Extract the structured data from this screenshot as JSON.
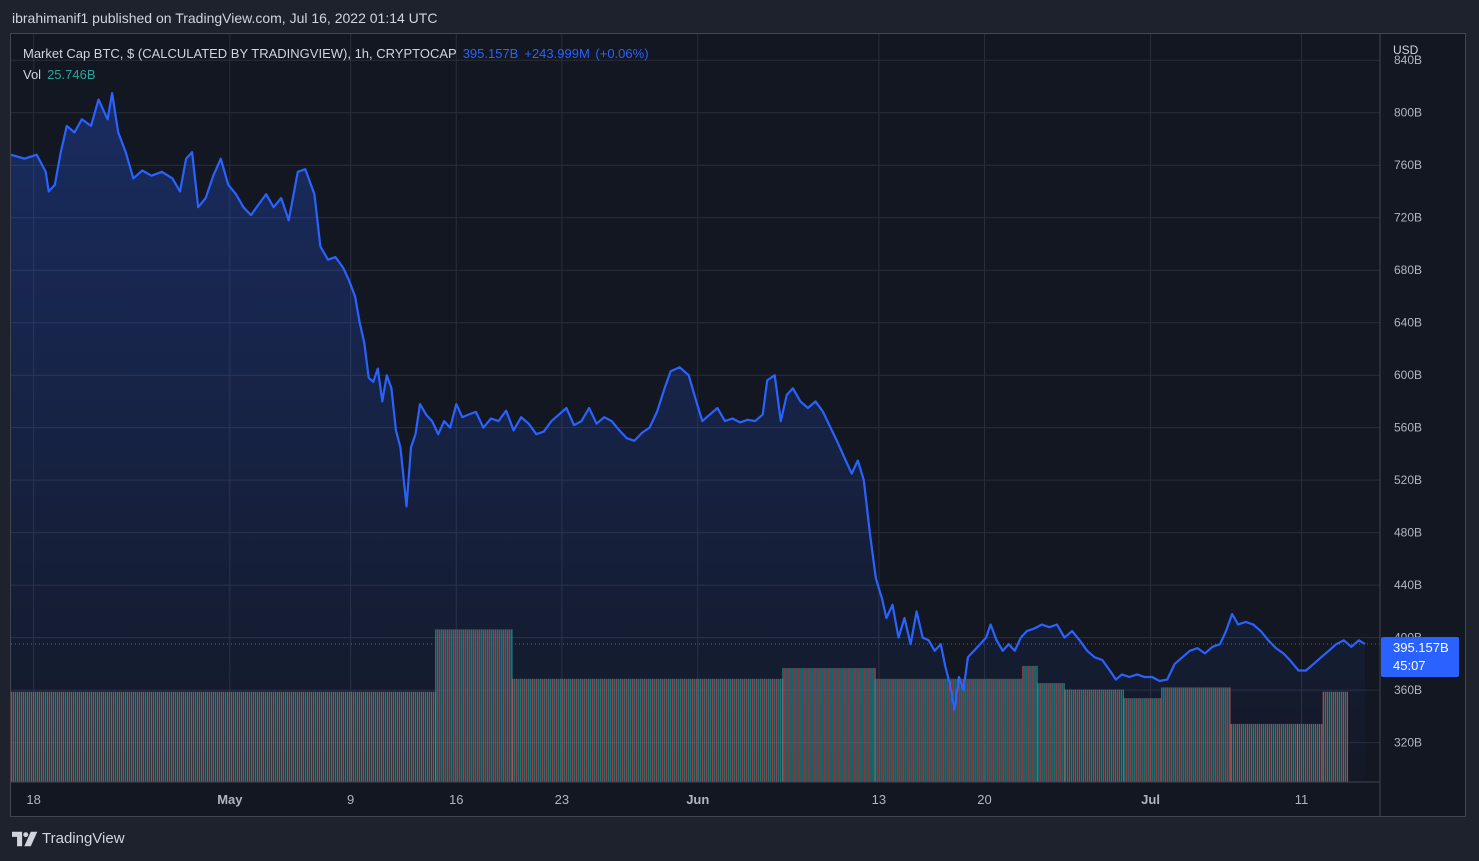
{
  "header": {
    "publisher_text": "ibrahimanif1 published on TradingView.com, Jul 16, 2022 01:14 UTC"
  },
  "legend": {
    "symbol": "Market Cap BTC, $ (CALCULATED BY TRADINGVIEW), 1h, CRYPTOCAP",
    "last_value": "395.157B",
    "change": "+243.999M",
    "change_pct": "(+0.06%)",
    "vol_label": "Vol",
    "vol_value": "25.746B"
  },
  "axis": {
    "currency": "USD"
  },
  "price_tag": {
    "value": "395.157B",
    "countdown": "45:07"
  },
  "footer": {
    "brand": "TradingView"
  },
  "colors": {
    "background": "#131722",
    "line": "#2962ff",
    "volume_up": "#26a69a",
    "volume_down": "#ef5350",
    "grid": "#2a2e39"
  },
  "chart_data": {
    "type": "line",
    "title": "Market Cap BTC",
    "xlabel": "",
    "ylabel": "USD",
    "ylim": [
      290,
      860
    ],
    "y_ticks": [
      320,
      360,
      400,
      440,
      480,
      520,
      560,
      600,
      640,
      680,
      720,
      760,
      800,
      840
    ],
    "y_tick_labels": [
      "320B",
      "360B",
      "400B",
      "440B",
      "480B",
      "520B",
      "560B",
      "600B",
      "640B",
      "680B",
      "720B",
      "760B",
      "800B",
      "840B"
    ],
    "x_ticks": [
      {
        "label": "18",
        "day": 0,
        "bold": false
      },
      {
        "label": "May",
        "day": 13,
        "bold": true
      },
      {
        "label": "9",
        "day": 21,
        "bold": false
      },
      {
        "label": "16",
        "day": 28,
        "bold": false
      },
      {
        "label": "23",
        "day": 35,
        "bold": false
      },
      {
        "label": "Jun",
        "day": 44,
        "bold": true
      },
      {
        "label": "13",
        "day": 56,
        "bold": false
      },
      {
        "label": "20",
        "day": 63,
        "bold": false
      },
      {
        "label": "Jul",
        "day": 74,
        "bold": true
      },
      {
        "label": "11",
        "day": 84,
        "bold": false
      }
    ],
    "x_domain": [
      -1.5,
      89.2
    ],
    "series": [
      {
        "points": [
          [
            -1.5,
            768
          ],
          [
            -0.6,
            765
          ],
          [
            0.2,
            768
          ],
          [
            0.8,
            755
          ],
          [
            1.0,
            740
          ],
          [
            1.4,
            745
          ],
          [
            1.8,
            770
          ],
          [
            2.2,
            790
          ],
          [
            2.7,
            785
          ],
          [
            3.2,
            795
          ],
          [
            3.8,
            790
          ],
          [
            4.3,
            810
          ],
          [
            4.9,
            795
          ],
          [
            5.2,
            815
          ],
          [
            5.6,
            785
          ],
          [
            6.1,
            770
          ],
          [
            6.6,
            750
          ],
          [
            7.2,
            756
          ],
          [
            7.8,
            752
          ],
          [
            8.5,
            755
          ],
          [
            9.2,
            750
          ],
          [
            9.7,
            740
          ],
          [
            10.1,
            765
          ],
          [
            10.5,
            770
          ],
          [
            10.9,
            728
          ],
          [
            11.4,
            735
          ],
          [
            11.9,
            752
          ],
          [
            12.4,
            765
          ],
          [
            12.9,
            745
          ],
          [
            13.4,
            738
          ],
          [
            13.9,
            728
          ],
          [
            14.4,
            722
          ],
          [
            14.9,
            730
          ],
          [
            15.4,
            738
          ],
          [
            15.9,
            728
          ],
          [
            16.4,
            735
          ],
          [
            16.9,
            718
          ],
          [
            17.5,
            755
          ],
          [
            18.0,
            757
          ],
          [
            18.6,
            738
          ],
          [
            19.0,
            698
          ],
          [
            19.5,
            688
          ],
          [
            20.0,
            690
          ],
          [
            20.5,
            682
          ],
          [
            20.9,
            672
          ],
          [
            21.3,
            660
          ],
          [
            21.6,
            640
          ],
          [
            21.9,
            625
          ],
          [
            22.2,
            598
          ],
          [
            22.5,
            595
          ],
          [
            22.8,
            605
          ],
          [
            23.1,
            580
          ],
          [
            23.4,
            600
          ],
          [
            23.7,
            590
          ],
          [
            24.0,
            558
          ],
          [
            24.3,
            545
          ],
          [
            24.5,
            523
          ],
          [
            24.7,
            500
          ],
          [
            25.0,
            545
          ],
          [
            25.3,
            555
          ],
          [
            25.6,
            578
          ],
          [
            26.0,
            570
          ],
          [
            26.4,
            565
          ],
          [
            26.8,
            555
          ],
          [
            27.2,
            565
          ],
          [
            27.6,
            560
          ],
          [
            28.0,
            578
          ],
          [
            28.4,
            568
          ],
          [
            28.8,
            570
          ],
          [
            29.3,
            572
          ],
          [
            29.8,
            560
          ],
          [
            30.3,
            567
          ],
          [
            30.8,
            565
          ],
          [
            31.3,
            573
          ],
          [
            31.8,
            558
          ],
          [
            32.3,
            568
          ],
          [
            32.8,
            563
          ],
          [
            33.3,
            555
          ],
          [
            33.8,
            557
          ],
          [
            34.3,
            565
          ],
          [
            34.8,
            570
          ],
          [
            35.3,
            575
          ],
          [
            35.8,
            562
          ],
          [
            36.3,
            565
          ],
          [
            36.8,
            575
          ],
          [
            37.3,
            563
          ],
          [
            37.8,
            568
          ],
          [
            38.3,
            565
          ],
          [
            38.8,
            558
          ],
          [
            39.3,
            552
          ],
          [
            39.8,
            550
          ],
          [
            40.3,
            556
          ],
          [
            40.8,
            560
          ],
          [
            41.3,
            572
          ],
          [
            41.8,
            590
          ],
          [
            42.2,
            603
          ],
          [
            42.8,
            606
          ],
          [
            43.4,
            600
          ],
          [
            43.9,
            580
          ],
          [
            44.3,
            565
          ],
          [
            44.8,
            570
          ],
          [
            45.3,
            575
          ],
          [
            45.8,
            565
          ],
          [
            46.3,
            567
          ],
          [
            46.8,
            564
          ],
          [
            47.3,
            566
          ],
          [
            47.8,
            565
          ],
          [
            48.3,
            570
          ],
          [
            48.6,
            596
          ],
          [
            49.1,
            600
          ],
          [
            49.5,
            565
          ],
          [
            49.9,
            585
          ],
          [
            50.3,
            590
          ],
          [
            50.8,
            580
          ],
          [
            51.3,
            575
          ],
          [
            51.8,
            580
          ],
          [
            52.3,
            572
          ],
          [
            52.8,
            560
          ],
          [
            53.3,
            548
          ],
          [
            53.8,
            535
          ],
          [
            54.2,
            525
          ],
          [
            54.6,
            535
          ],
          [
            55.0,
            520
          ],
          [
            55.4,
            480
          ],
          [
            55.8,
            445
          ],
          [
            56.2,
            430
          ],
          [
            56.5,
            415
          ],
          [
            56.9,
            425
          ],
          [
            57.3,
            400
          ],
          [
            57.7,
            415
          ],
          [
            58.1,
            395
          ],
          [
            58.5,
            420
          ],
          [
            58.9,
            400
          ],
          [
            59.3,
            398
          ],
          [
            59.7,
            390
          ],
          [
            60.1,
            395
          ],
          [
            60.4,
            378
          ],
          [
            60.7,
            365
          ],
          [
            61.0,
            345
          ],
          [
            61.3,
            370
          ],
          [
            61.6,
            360
          ],
          [
            61.9,
            385
          ],
          [
            62.3,
            390
          ],
          [
            62.7,
            395
          ],
          [
            63.1,
            400
          ],
          [
            63.4,
            410
          ],
          [
            63.8,
            398
          ],
          [
            64.2,
            390
          ],
          [
            64.6,
            395
          ],
          [
            65.0,
            390
          ],
          [
            65.4,
            400
          ],
          [
            65.8,
            405
          ],
          [
            66.3,
            407
          ],
          [
            66.8,
            410
          ],
          [
            67.3,
            408
          ],
          [
            67.8,
            410
          ],
          [
            68.3,
            400
          ],
          [
            68.8,
            405
          ],
          [
            69.3,
            398
          ],
          [
            69.8,
            390
          ],
          [
            70.3,
            385
          ],
          [
            70.8,
            383
          ],
          [
            71.3,
            375
          ],
          [
            71.7,
            368
          ],
          [
            72.1,
            372
          ],
          [
            72.6,
            370
          ],
          [
            73.1,
            372
          ],
          [
            73.6,
            370
          ],
          [
            74.1,
            370
          ],
          [
            74.6,
            367
          ],
          [
            75.1,
            368
          ],
          [
            75.6,
            380
          ],
          [
            76.1,
            385
          ],
          [
            76.6,
            390
          ],
          [
            77.1,
            392
          ],
          [
            77.6,
            388
          ],
          [
            78.1,
            393
          ],
          [
            78.6,
            395
          ],
          [
            79.0,
            405
          ],
          [
            79.4,
            418
          ],
          [
            79.8,
            410
          ],
          [
            80.3,
            412
          ],
          [
            80.8,
            410
          ],
          [
            81.3,
            405
          ],
          [
            81.8,
            398
          ],
          [
            82.3,
            392
          ],
          [
            82.8,
            388
          ],
          [
            83.3,
            382
          ],
          [
            83.8,
            375
          ],
          [
            84.3,
            375
          ],
          [
            84.8,
            380
          ],
          [
            85.3,
            385
          ],
          [
            85.8,
            390
          ],
          [
            86.3,
            395
          ],
          [
            86.8,
            398
          ],
          [
            87.3,
            393
          ],
          [
            87.8,
            398
          ],
          [
            88.2,
            395.157
          ]
        ]
      }
    ],
    "volume": {
      "ylim": [
        0,
        100
      ],
      "bars": [
        {
          "start": -1.5,
          "end": 26.6,
          "value": 42
        },
        {
          "start": 26.6,
          "end": 31.7,
          "value": 71
        },
        {
          "start": 31.7,
          "end": 49.6,
          "value": 48
        },
        {
          "start": 49.6,
          "end": 55.7,
          "value": 53
        },
        {
          "start": 55.7,
          "end": 65.5,
          "value": 48
        },
        {
          "start": 65.5,
          "end": 66.5,
          "value": 54
        },
        {
          "start": 66.5,
          "end": 68.3,
          "value": 46
        },
        {
          "start": 68.3,
          "end": 72.2,
          "value": 43
        },
        {
          "start": 72.2,
          "end": 74.7,
          "value": 39
        },
        {
          "start": 74.7,
          "end": 79.3,
          "value": 44
        },
        {
          "start": 79.3,
          "end": 83.7,
          "value": 27
        },
        {
          "start": 83.7,
          "end": 85.4,
          "value": 27
        },
        {
          "start": 85.4,
          "end": 87.0,
          "value": 42
        }
      ]
    }
  }
}
